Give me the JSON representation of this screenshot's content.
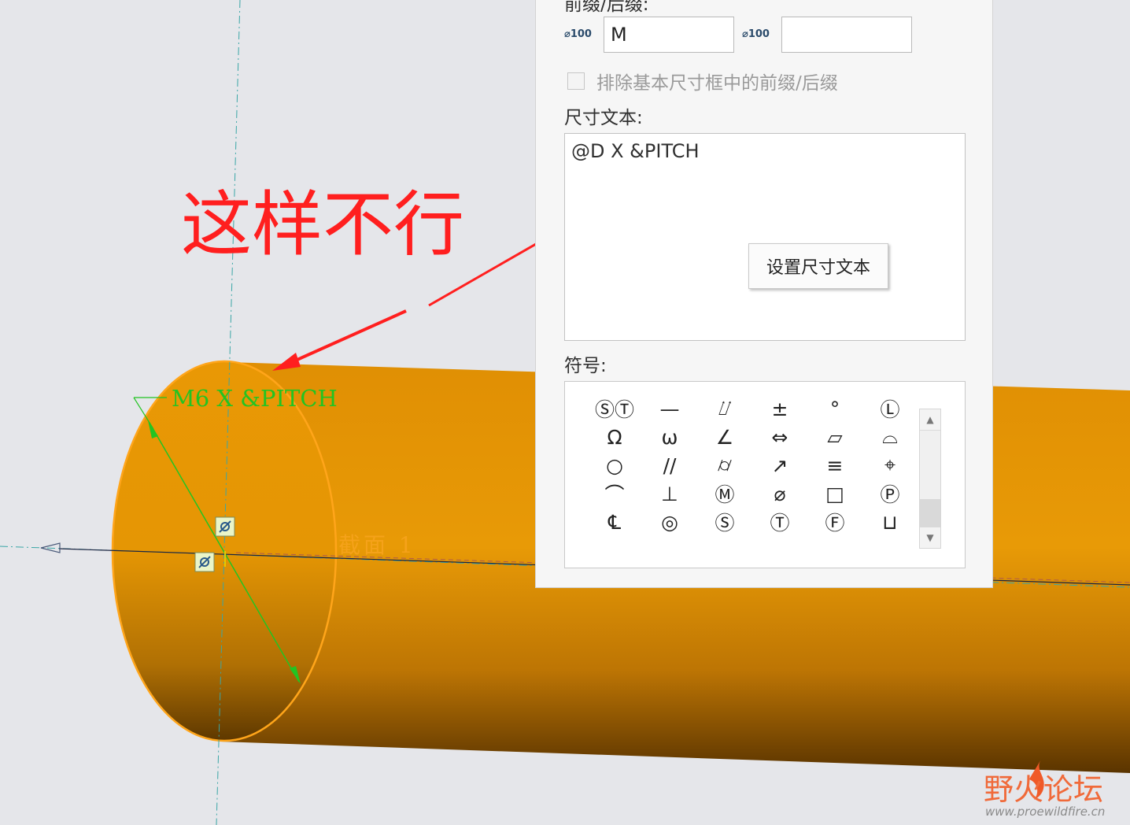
{
  "panel": {
    "prefix_suffix_label": "前缀/后缀:",
    "prefix_icon": "⌀100",
    "prefix_value": "M",
    "suffix_icon": "⌀100",
    "suffix_value": "",
    "exclude_label": "排除基本尺寸框中的前缀/后缀",
    "exclude_checked": false,
    "dim_text_label": "尺寸文本:",
    "dim_text_value": "@D X &PITCH",
    "set_dim_text_button": "设置尺寸文本",
    "symbols_label": "符号:"
  },
  "symbols": [
    "ⓈⓉ",
    "—",
    "⌰",
    "±",
    "°",
    "Ⓛ",
    "Ω",
    "ω",
    "∠",
    "⇔",
    "▱",
    "⌓",
    "○",
    "//",
    "⌭",
    "↗",
    "≡",
    "⌖",
    "⌒",
    "⊥",
    "Ⓜ",
    "⌀",
    "□",
    "Ⓟ",
    "℄",
    "◎",
    "Ⓢ",
    "Ⓣ",
    "Ⓕ",
    "⊔"
  ],
  "viewport": {
    "annotation": "这样不行",
    "dimension_text": "M6 X &PITCH",
    "section_label": "截面 1"
  },
  "watermark": {
    "brand": "野火论坛",
    "url": "www.proewildfire.cn"
  },
  "colors": {
    "cylinder": "#e39505",
    "annotation": "#ff1f1f",
    "dimension": "#22c422",
    "section_outline": "#ffa51a"
  }
}
